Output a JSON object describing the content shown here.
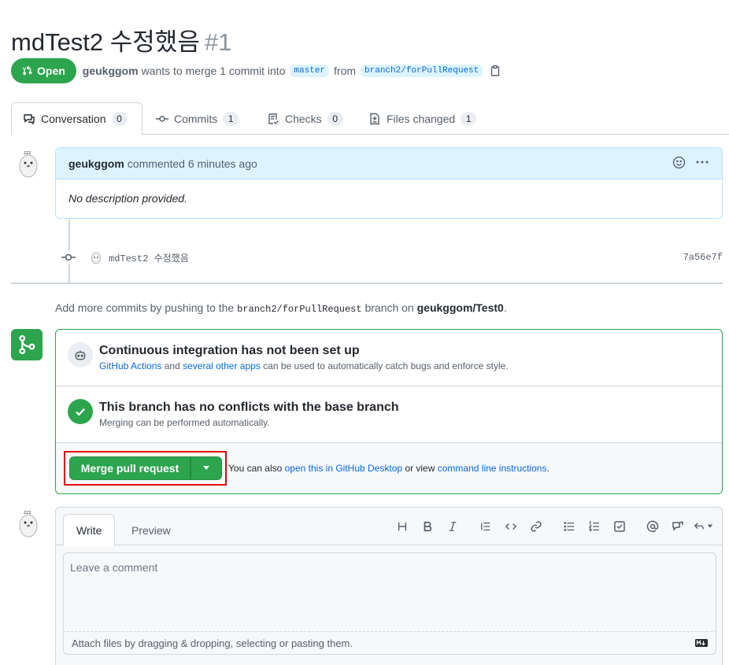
{
  "pr": {
    "title": "mdTest2 수정했음",
    "number": "#1",
    "state": "Open",
    "author": "geukggom",
    "merge_text": "wants to merge 1 commit into",
    "base_branch": "master",
    "from_text": "from",
    "head_branch": "branch2/forPullRequest"
  },
  "tabs": [
    {
      "label": "Conversation",
      "count": "0"
    },
    {
      "label": "Commits",
      "count": "1"
    },
    {
      "label": "Checks",
      "count": "0"
    },
    {
      "label": "Files changed",
      "count": "1"
    }
  ],
  "comment": {
    "author": "geukggom",
    "meta": "commented 6 minutes ago",
    "body": "No description provided."
  },
  "commit": {
    "message": "mdTest2 수정했음",
    "sha": "7a56e7f"
  },
  "add_commits": {
    "prefix": "Add more commits by pushing to the",
    "branch": "branch2/forPullRequest",
    "mid": "branch on",
    "repo": "geukggom/Test0",
    "suffix": "."
  },
  "merge_box": {
    "ci_title": "Continuous integration has not been set up",
    "ci_link1": "GitHub Actions",
    "ci_and": "and",
    "ci_link2": "several other apps",
    "ci_rest": "can be used to automatically catch bugs and enforce style.",
    "conflict_title": "This branch has no conflicts with the base branch",
    "conflict_desc": "Merging can be performed automatically.",
    "merge_button": "Merge pull request",
    "also_prefix": "You can also",
    "also_link1": "open this in GitHub Desktop",
    "also_mid": "or view",
    "also_link2": "command line instructions",
    "also_suffix": "."
  },
  "editor": {
    "tab_write": "Write",
    "tab_preview": "Preview",
    "placeholder": "Leave a comment",
    "attach_text": "Attach files by dragging & dropping, selecting or pasting them."
  },
  "colors": {
    "green": "#2da44e",
    "blue_link": "#0969da",
    "highlight_red": "#e3000f"
  }
}
